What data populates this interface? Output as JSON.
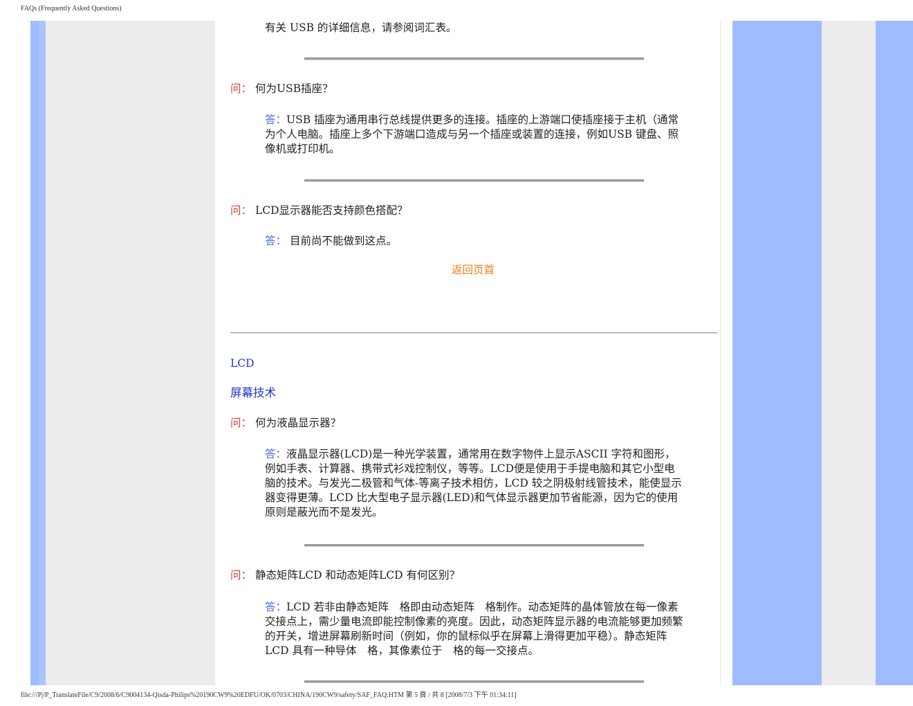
{
  "print_header": "FAQs (Frequently Asked Questions)",
  "print_footer": "file:///P|/P_TranslateFile/C9/2008/6/C9004134-Qisda-Philips%20190CW9%20EDFU/OK/0703/CHINA/190CW9/safety/SAF_FAQ.HTM 第 5 頁 / 共 8 [2008/7/3 下午 01:34:11]",
  "colors": {
    "question_label": "#d93a32",
    "answer_label": "#4b6be8",
    "section_link": "#2233cc",
    "back_to_top": "#f07c17",
    "side_blue": "#9ebcff",
    "side_gray": "#ececec"
  },
  "usb_tail": "有关 USB 的详细信息，请参阅词汇表。",
  "qa1": {
    "q_label": "问：",
    "question": "何为USB插座？",
    "a_label": "答：",
    "answer": "USB 插座为通用串行总线提供更多的连接。插座的上游端口使插座接于主机（通常为个人电脑。插座上多个下游端口造成与另一个插座或装置的连接，例如USB 键盘、照像机或打印机。"
  },
  "qa2": {
    "q_label": "问：",
    "question": "LCD显示器能否支持颜色搭配？",
    "a_label": "答：",
    "answer": "目前尚不能做到这点。"
  },
  "back_to_top": "返回页首",
  "section": {
    "title": "LCD",
    "subtitle": "屏幕技术"
  },
  "qa3": {
    "q_label": "问：",
    "question": "何为液晶显示器？",
    "a_label": "答：",
    "answer": "液晶显示器(LCD)是一种光学装置，通常用在数字物件上显示ASCII 字符和图形，例如手表、计算器、携带式衫戏控制仪，等等。LCD便是使用于手提电脑和其它小型电脑的技术。与发光二极管和气体-等离子技术相仿，LCD 较之阴极射线管技术，能使显示器变得更薄。LCD 比大型电子显示器(LED)和气体显示器更加节省能源，因为它的使用原则是蔽光而不是发光。"
  },
  "qa4": {
    "q_label": "问：",
    "question": "静态矩阵LCD 和动态矩阵LCD 有何区别？",
    "a_label": "答：",
    "answer": "LCD 若非由静态矩阵　格即由动态矩阵　格制作。动态矩阵的晶体管放在每一像素交接点上，需少量电流即能控制像素的亮度。因此，动态矩阵显示器的电流能够更加频繁的开关，增进屏幕刷新时间（例如，你的鼠标似乎在屏幕上滑得更加平稳）。静态矩阵LCD 具有一种导体　格，其像素位于　格的每一交接点。"
  }
}
